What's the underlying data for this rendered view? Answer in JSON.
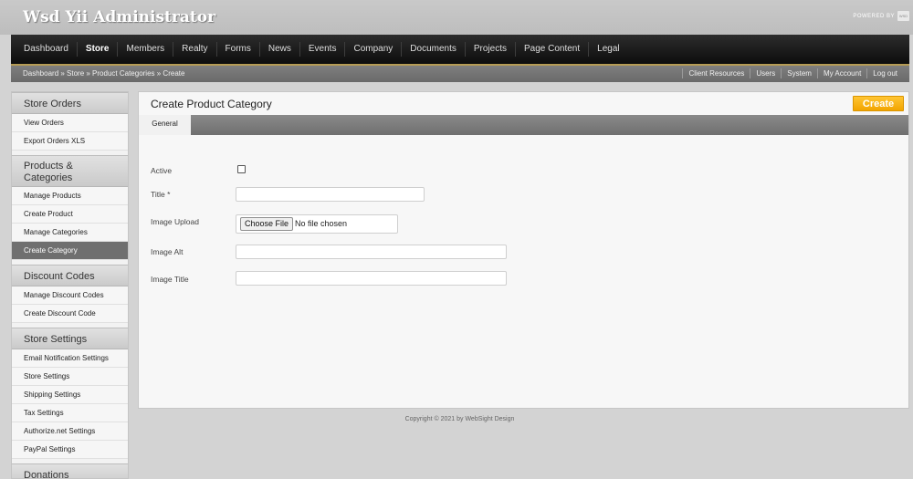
{
  "header": {
    "app_title": "Wsd Yii Administrator",
    "powered_by": "POWERED BY",
    "powered_logo": "WSD"
  },
  "nav": {
    "items": [
      "Dashboard",
      "Store",
      "Members",
      "Realty",
      "Forms",
      "News",
      "Events",
      "Company",
      "Documents",
      "Projects",
      "Page Content",
      "Legal"
    ],
    "active": "Store"
  },
  "breadcrumb": "Dashboard » Store » Product Categories » Create",
  "util_links": [
    "Client Resources",
    "Users",
    "System",
    "My Account",
    "Log out"
  ],
  "sidebar": {
    "sections": [
      {
        "title": "Store Orders",
        "items": [
          "View Orders",
          "Export Orders XLS"
        ]
      },
      {
        "title": "Products & Categories",
        "items": [
          "Manage Products",
          "Create Product",
          "Manage Categories",
          "Create Category"
        ]
      },
      {
        "title": "Discount Codes",
        "items": [
          "Manage Discount Codes",
          "Create Discount Code"
        ]
      },
      {
        "title": "Store Settings",
        "items": [
          "Email Notification Settings",
          "Store Settings",
          "Shipping Settings",
          "Tax Settings",
          "Authorize.net Settings",
          "PayPal Settings"
        ]
      },
      {
        "title": "Donations",
        "items": []
      }
    ],
    "active_item": "Create Category"
  },
  "main": {
    "title": "Create Product Category",
    "create_label": "Create",
    "tab_general": "General",
    "fields": {
      "active_label": "Active",
      "title_label": "Title *",
      "title_value": "",
      "image_upload_label": "Image Upload",
      "choose_file_label": "Choose File",
      "no_file_label": "No file chosen",
      "image_alt_label": "Image Alt",
      "image_alt_value": "",
      "image_title_label": "Image Title",
      "image_title_value": ""
    }
  },
  "footer": "Copyright © 2021 by WebSight Design",
  "colors": {
    "accent_button": "#f2a500",
    "nav_background": "#1a1a1a",
    "crumb_underline": "#b59b54",
    "page_background": "#d3d3d3"
  }
}
